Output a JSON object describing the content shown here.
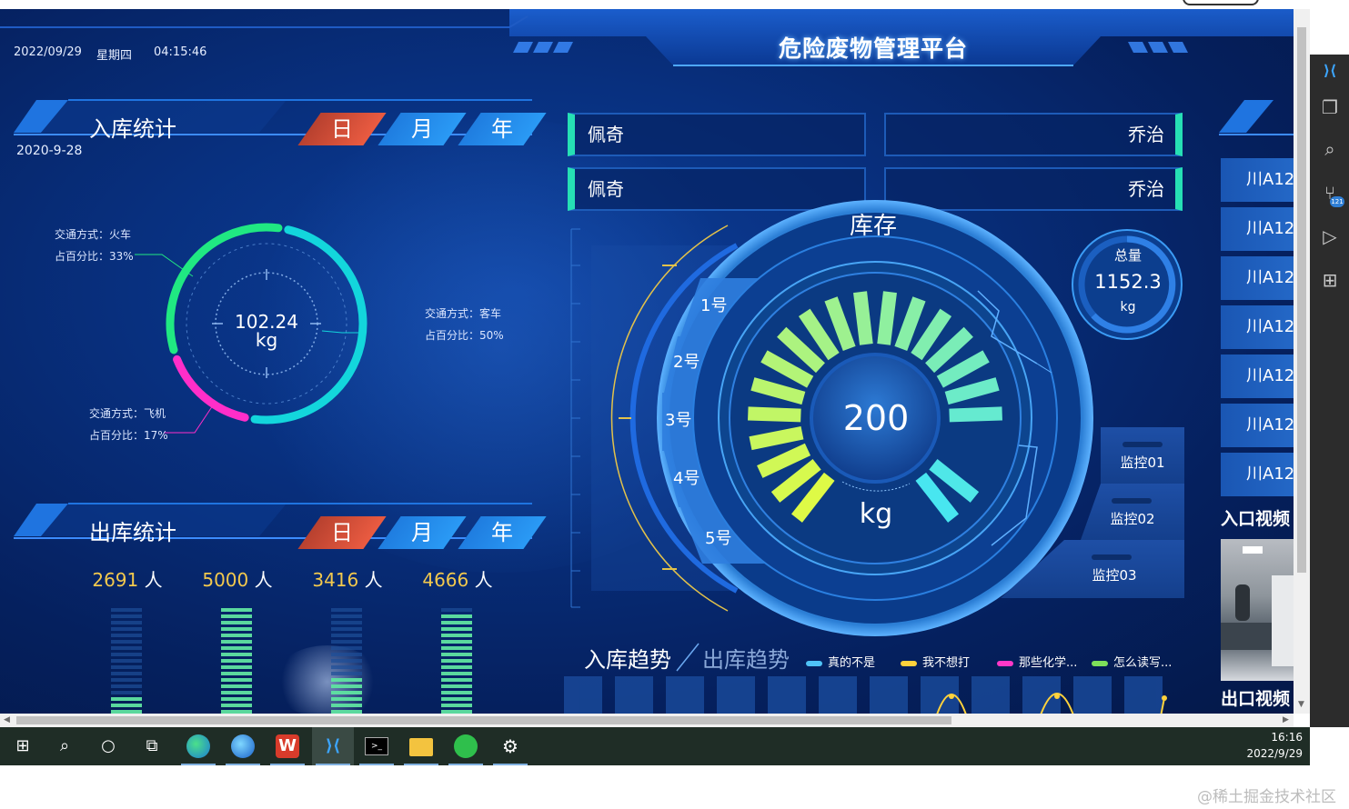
{
  "header": {
    "date": "2022/09/29",
    "weekday": "星期四",
    "time": "04:15:46",
    "title": "危险废物管理平台"
  },
  "inbound": {
    "title": "入库统计",
    "tabs": [
      "日",
      "月",
      "年"
    ],
    "active_tab": "日",
    "date": "2020-9-28",
    "donut": {
      "value": "102.24",
      "unit": "kg",
      "segments": [
        {
          "mode_label": "交通方式：火车",
          "percent_label": "占百分比：33%",
          "percent": 33,
          "color": "#20e882"
        },
        {
          "mode_label": "交通方式：客车",
          "percent_label": "占百分比：50%",
          "percent": 50,
          "color": "#13d6dc"
        },
        {
          "mode_label": "交通方式：飞机",
          "percent_label": "占百分比：17%",
          "percent": 17,
          "color": "#ff2ec9"
        }
      ]
    }
  },
  "outbound": {
    "title": "出库统计",
    "tabs": [
      "日",
      "月",
      "年"
    ],
    "active_tab": "日",
    "unit": "人",
    "counts": [
      {
        "value": "2691",
        "level": 0.2
      },
      {
        "value": "5000",
        "level": 1.0
      },
      {
        "value": "3416",
        "level": 0.35
      },
      {
        "value": "4666",
        "level": 0.95
      }
    ]
  },
  "names": {
    "row1_left": "佩奇",
    "row1_right": "乔治",
    "row2_left": "佩奇",
    "row2_right": "乔治"
  },
  "inventory": {
    "title": "库存",
    "value": "200",
    "unit": "kg",
    "slots": [
      "1号",
      "2号",
      "3号",
      "4号",
      "5号"
    ],
    "total_label": "总量",
    "total_value": "1152.3",
    "total_unit": "kg",
    "monitors": [
      "监控01",
      "监控02",
      "监控03"
    ]
  },
  "trend": {
    "tab_in": "入库趋势",
    "tab_out": "出库趋势",
    "legend": [
      {
        "name": "真的不是",
        "color": "#4fc3f7"
      },
      {
        "name": "我不想打",
        "color": "#ffd23c"
      },
      {
        "name": "那些化学...",
        "color": "#ff38c8"
      },
      {
        "name": "怎么读写...",
        "color": "#7ee05a"
      }
    ]
  },
  "right_panel": {
    "plates": [
      "川A12",
      "川A12",
      "川A12",
      "川A12",
      "川A12",
      "川A12",
      "川A12"
    ],
    "entrance_video": "入口视频",
    "exit_video": "出口视频"
  },
  "taskbar": {
    "time": "16:16",
    "date": "2022/9/29"
  },
  "watermark": "@稀土掘金技术社区"
}
